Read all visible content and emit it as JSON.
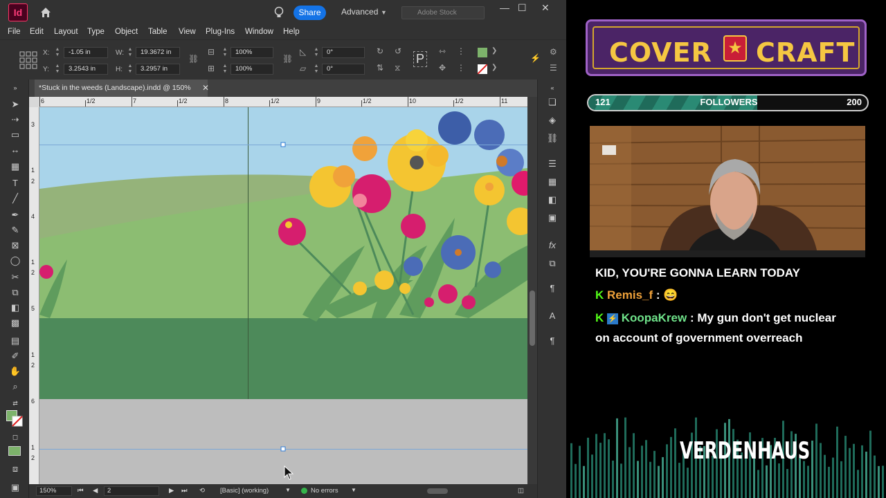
{
  "app": {
    "logo": "Id",
    "share_label": "Share",
    "workspace": "Advanced",
    "stock_placeholder": "Adobe Stock",
    "menu": [
      "File",
      "Edit",
      "Layout",
      "Type",
      "Object",
      "Table",
      "View",
      "Plug-Ins",
      "Window",
      "Help"
    ],
    "controls": {
      "x_label": "X:",
      "x_value": "-1.05 in",
      "y_label": "Y:",
      "y_value": "3.2543 in",
      "w_label": "W:",
      "w_value": "19.3672 in",
      "h_label": "H:",
      "h_value": "3.2957 in",
      "scale_x": "100%",
      "scale_y": "100%",
      "rotate": "0°",
      "shear": "0°"
    },
    "document_tab": "*Stuck in the weeds (Landscape).indd @ 150%",
    "ruler_top": [
      "6",
      "1/2",
      "7",
      "1/2",
      "8",
      "1/2",
      "9",
      "1/2",
      "10",
      "1/2",
      "11"
    ],
    "ruler_left": [
      "3",
      "1",
      "2",
      "4",
      "1",
      "2",
      "5",
      "1",
      "2",
      "6",
      "1",
      "2"
    ],
    "status": {
      "zoom": "150%",
      "page": "2",
      "style": "[Basic] (working)",
      "errors": "No errors"
    },
    "colors": {
      "fill": "#7db36b",
      "accent": "#1473e6"
    }
  },
  "overlay": {
    "brand_left": "COVER",
    "brand_right": "CRAFT",
    "followers": {
      "current": "121",
      "label": "FOLLOWERS",
      "goal": "200",
      "progress": 0.605
    },
    "chat": [
      {
        "text": "KID, YOU'RE GONNA LEARN TODAY"
      },
      {
        "user": "Remis_f",
        "text": "😄"
      },
      {
        "user": "KoopaKrew",
        "text": "My gun don't get nuclear",
        "text2": "on account of government overreach"
      }
    ],
    "sponsor": "VERDENHAUS"
  }
}
